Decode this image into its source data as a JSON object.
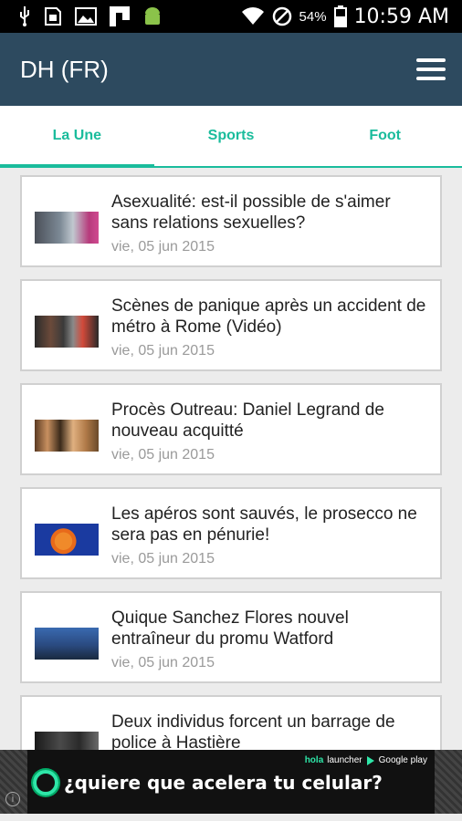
{
  "status_bar": {
    "battery_percent": "54%",
    "time": "10:59 AM",
    "icons": [
      "usb-icon",
      "sim-icon",
      "image-icon",
      "flipboard-icon",
      "android-icon",
      "wifi-icon",
      "no-signal-icon",
      "battery-icon"
    ]
  },
  "app": {
    "title": "DH (FR)",
    "accent_color": "#1abc9c",
    "bar_color": "#2d4a5f"
  },
  "tabs": [
    {
      "label": "La Une",
      "active": true
    },
    {
      "label": "Sports",
      "active": false
    },
    {
      "label": "Foot",
      "active": false
    }
  ],
  "articles": [
    {
      "title": "Asexualité: est-il possible de s'aimer sans relations sexuelles?",
      "date": "vie, 05 jun 2015"
    },
    {
      "title": "Scènes de panique après un accident de métro à Rome (Vidéo)",
      "date": "vie, 05 jun 2015"
    },
    {
      "title": "Procès Outreau: Daniel Legrand de nouveau acquitté",
      "date": "vie, 05 jun 2015"
    },
    {
      "title": "Les apéros sont sauvés, le prosecco ne sera pas en pénurie!",
      "date": "vie, 05 jun 2015"
    },
    {
      "title": "Quique Sanchez Flores nouvel entraîneur du promu Watford",
      "date": "vie, 05 jun 2015"
    },
    {
      "title": "Deux individus forcent un barrage de police à Hastière",
      "date": ""
    }
  ],
  "ad": {
    "text": "¿quiere que acelera tu celular?",
    "brand_hola": "hola",
    "brand_launcher": "launcher",
    "brand_store": "Google play"
  }
}
